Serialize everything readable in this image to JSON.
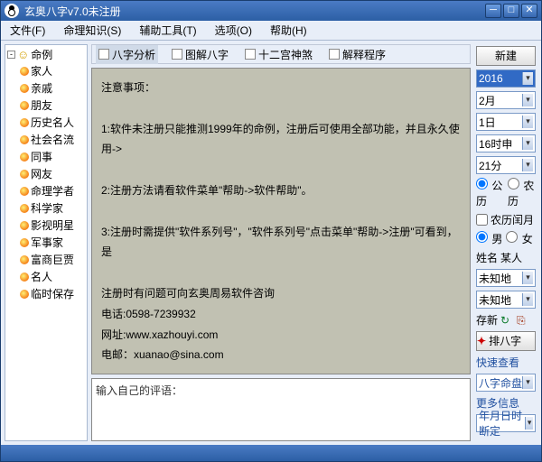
{
  "title": "玄奥八字v7.0未注册",
  "menus": [
    "文件(F)",
    "命理知识(S)",
    "辅助工具(T)",
    "选项(O)",
    "帮助(H)"
  ],
  "tree": {
    "root": "命例",
    "items": [
      "家人",
      "亲戚",
      "朋友",
      "历史名人",
      "社会名流",
      "同事",
      "网友",
      "命理学者",
      "科学家",
      "影视明星",
      "军事家",
      "富商巨贾",
      "名人",
      "临时保存"
    ]
  },
  "tabs": [
    "八字分析",
    "图解八字",
    "十二宫神煞",
    "解释程序"
  ],
  "notice": "注意事项：\n\n1:软件未注册只能推测1999年的命例，注册后可使用全部功能，并且永久使用->\n\n2:注册方法请看软件菜单\"帮助->软件帮助\"。\n\n3:注册时需提供\"软件系列号\"，\"软件系列号\"点击菜单\"帮助->注册\"可看到，是\n\n注册时有问题可向玄奥周易软件咨询\n电话:0598-7239932\n网址:www.xazhouyi.com\n电邮：xuanao@sina.com",
  "commentPlaceholder": "输入自己的评语：",
  "right": {
    "new": "新建",
    "year": "2016",
    "month": "2月",
    "day": "1日",
    "hour": "16时申",
    "minute": "21分",
    "calSolar": "公历",
    "calLunar": "农历",
    "leap": "农历闰月",
    "sexM": "男",
    "sexF": "女",
    "nameLabel": "姓名",
    "nameValue": "某人",
    "place1": "未知地",
    "place2": "未知地",
    "save": "存新",
    "paiba": "排八字",
    "quickLook": "快速查看",
    "quickSel": "八字命盘",
    "moreInfo": "更多信息",
    "moreSel": "年月日时断定"
  }
}
